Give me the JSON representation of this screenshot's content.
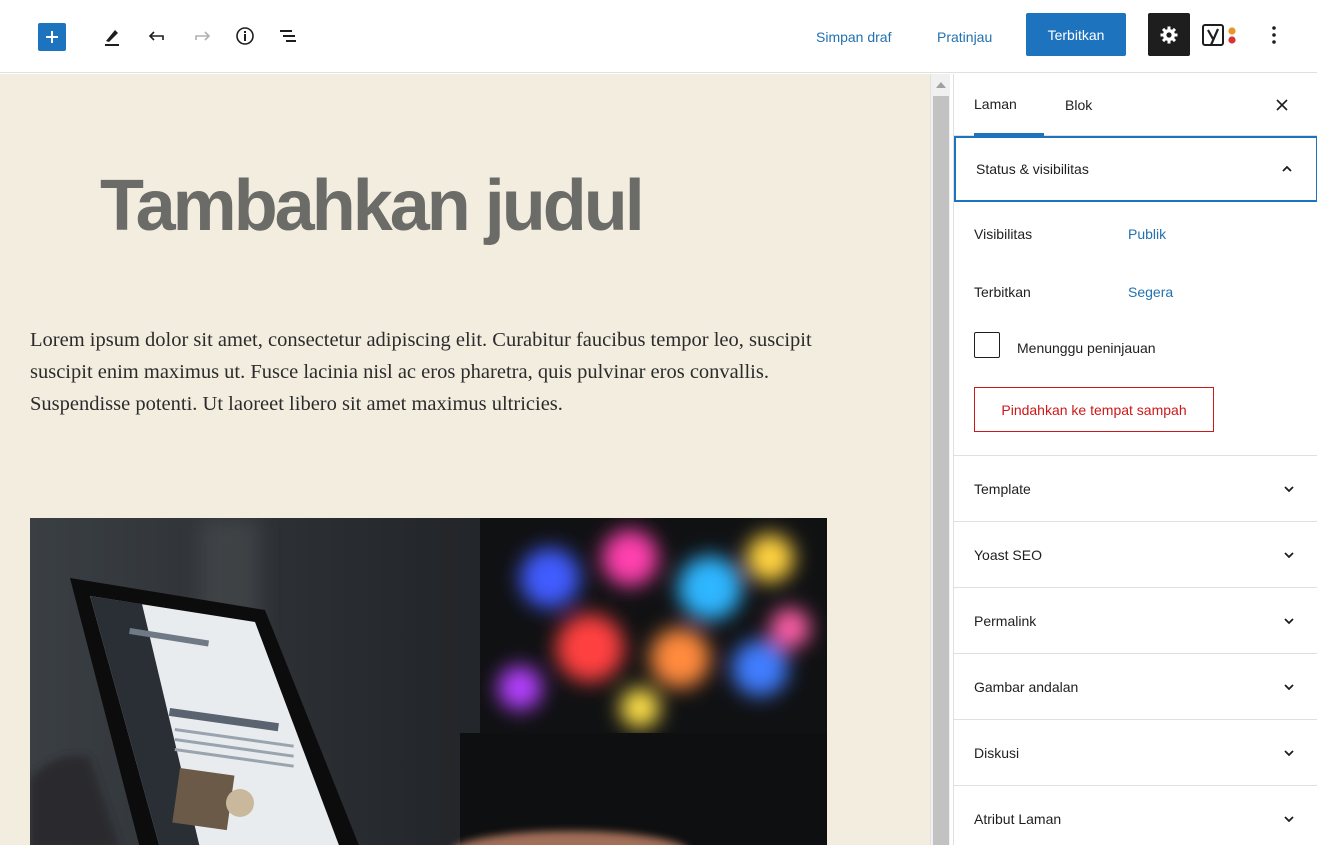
{
  "toolbar": {
    "add_icon": "plus-icon",
    "tools_icon": "pencil-icon",
    "undo_icon": "undo-icon",
    "redo_icon": "redo-icon",
    "details_icon": "info-icon",
    "outline_icon": "list-view-icon",
    "save_draft": "Simpan draf",
    "preview": "Pratinjau",
    "publish": "Terbitkan",
    "settings_icon": "gear-icon",
    "yoast_icon": "yoast-icon",
    "more_icon": "more-vertical-icon",
    "accent_color": "#1e73be"
  },
  "editor": {
    "title": "Tambahkan judul",
    "paragraph": "Lorem ipsum dolor sit amet, consectetur adipiscing elit. Curabitur faucibus tempor leo, suscipit suscipit enim maximus ut. Fusce lacinia nisl ac eros pharetra, quis pulvinar eros convallis. Suspendisse potenti. Ut laoreet libero sit amet maximus ultricies.",
    "image_description": "laptop-photo",
    "background_color": "#f3ede0"
  },
  "sidebar": {
    "tabs": [
      {
        "label": "Laman",
        "active": true
      },
      {
        "label": "Blok",
        "active": false
      }
    ],
    "close_icon": "close-icon",
    "status_panel": {
      "title": "Status & visibilitas",
      "visibility_label": "Visibilitas",
      "visibility_value": "Publik",
      "publish_label": "Terbitkan",
      "publish_value": "Segera",
      "pending_review_label": "Menunggu peninjauan",
      "pending_review_checked": false,
      "trash_button": "Pindahkan ke tempat sampah"
    },
    "panels": [
      {
        "title": "Template"
      },
      {
        "title": "Yoast SEO"
      },
      {
        "title": "Permalink"
      },
      {
        "title": "Gambar andalan"
      },
      {
        "title": "Diskusi"
      },
      {
        "title": "Atribut Laman"
      }
    ]
  }
}
